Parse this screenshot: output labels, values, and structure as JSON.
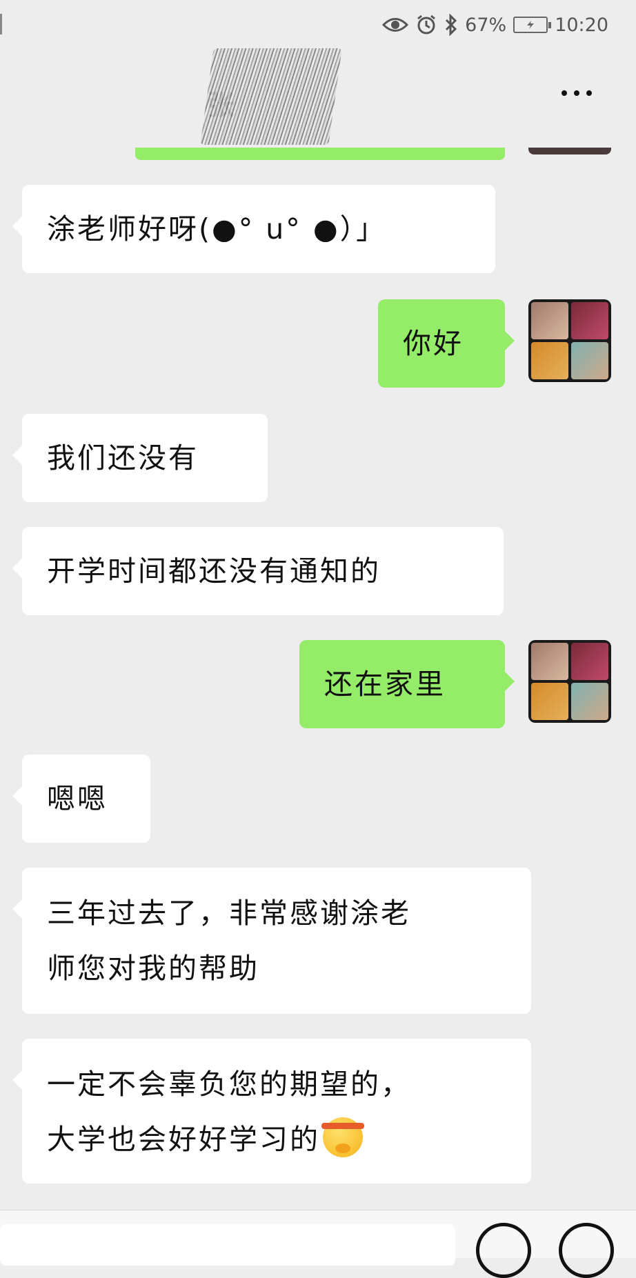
{
  "status_bar": {
    "battery": "67%",
    "time": "10:20"
  },
  "header": {
    "title": "张"
  },
  "messages": [
    {
      "side": "left",
      "text": "涂老师好呀(●° u° ●）」"
    },
    {
      "side": "right",
      "text": "你好"
    },
    {
      "side": "left",
      "text": "我们还没有"
    },
    {
      "side": "left",
      "text": "开学时间都还没有通知的"
    },
    {
      "side": "right",
      "text": "还在家里"
    },
    {
      "side": "left",
      "text": "嗯嗯"
    },
    {
      "side": "left",
      "text": "三年过去了，非常感谢涂老\n师您对我的帮助"
    },
    {
      "side": "left",
      "text": "一定不会辜负您的期望的，\n大学也会好好学习的"
    }
  ],
  "icons": {
    "status": [
      "eye-icon",
      "alarm-icon",
      "bluetooth-icon",
      "battery-icon"
    ],
    "header": [
      "more-icon"
    ],
    "bottom": [
      "emoji-button-icon",
      "plus-button-icon"
    ]
  },
  "colors": {
    "background": "#ededed",
    "sent_bubble": "#95ec69",
    "received_bubble": "#ffffff"
  }
}
